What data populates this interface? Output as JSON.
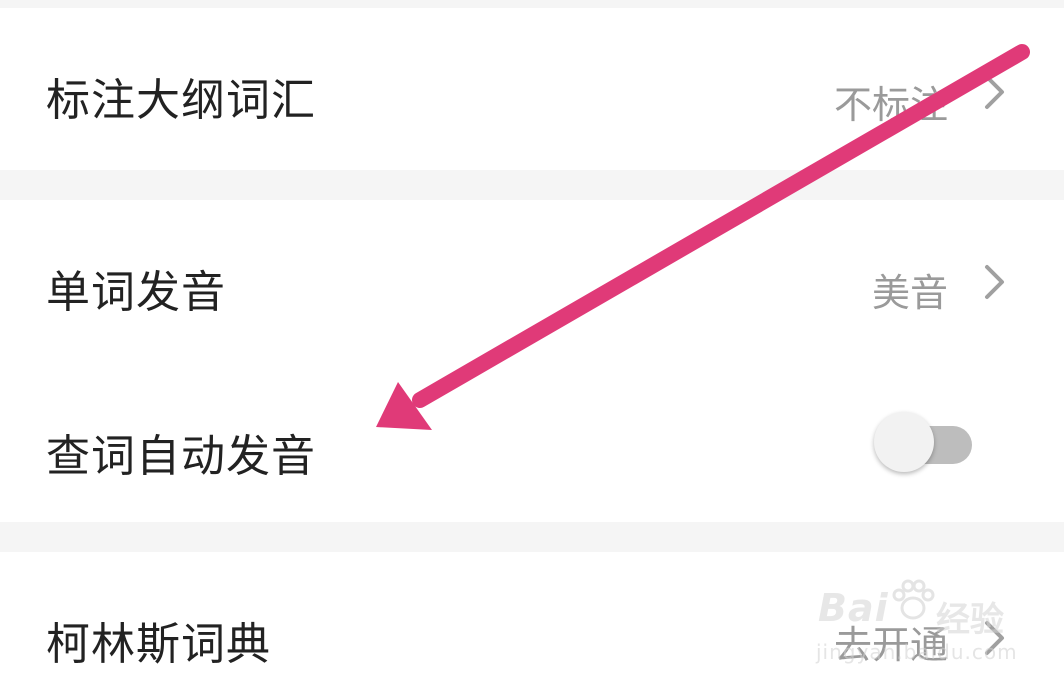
{
  "settings": {
    "rows": [
      {
        "label": "标注大纲词汇",
        "value": "不标注"
      },
      {
        "label": "单词发音",
        "value": "美音"
      },
      {
        "label": "查词自动发音",
        "toggle": "off"
      },
      {
        "label": "柯林斯词典",
        "value": "去开通"
      }
    ]
  },
  "overlay": {
    "arrow_color": "#e03a78"
  },
  "watermark": {
    "brand": "Bai",
    "jingyan": "经验",
    "url": "jingyan.baidu.com"
  },
  "icons": {
    "chevron": "chevron-right-icon",
    "paw": "baidu-paw-icon",
    "arrow": "annotation-arrow"
  }
}
